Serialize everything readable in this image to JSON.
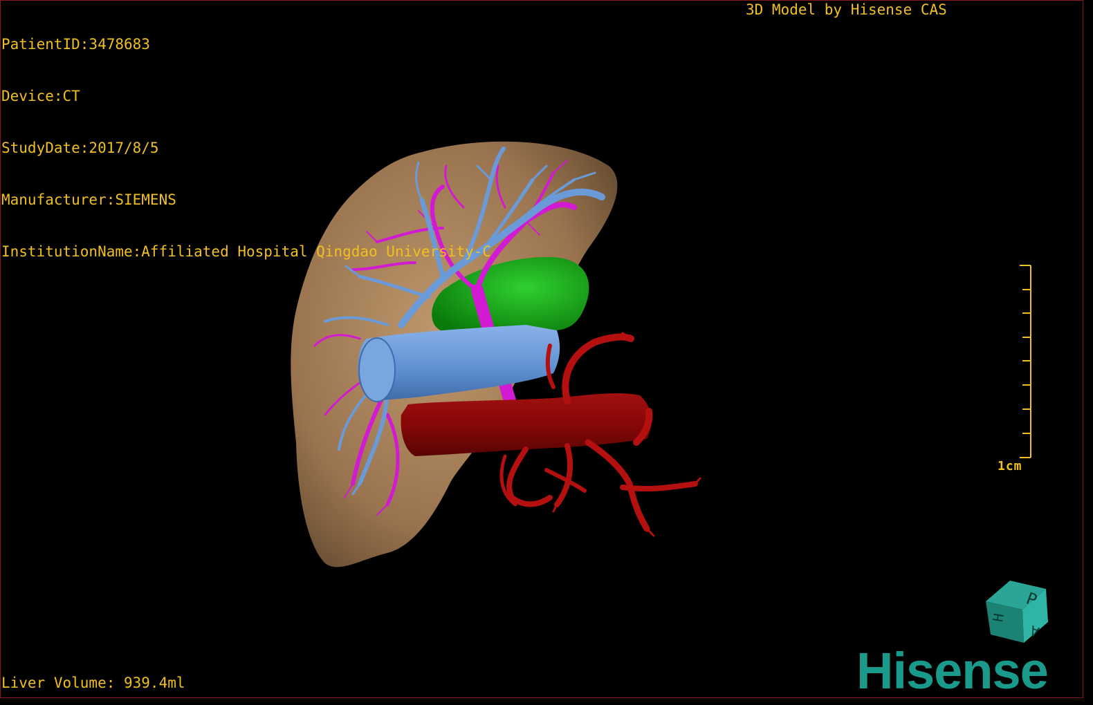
{
  "overlay": {
    "patient_id": "PatientID:3478683",
    "device": "Device:CT",
    "study_date": "StudyDate:2017/8/5",
    "manufacturer": "Manufacturer:SIEMENS",
    "institution": "InstitutionName:Affiliated Hospital Qingdao University-C",
    "model_credit": "3D Model by Hisense CAS",
    "liver_volume": "Liver Volume: 939.4ml"
  },
  "scale_bar": {
    "label": "1cm"
  },
  "orientation_cube": {
    "faces": [
      "P",
      "H",
      "A"
    ],
    "icon": "orientation-cube-icon"
  },
  "brand": {
    "name": "Hisense",
    "color": "#1a9a8a"
  },
  "colors": {
    "text": "#f0c020",
    "liver": "#b48c64",
    "portal_vein": "#6a9ad8",
    "hepatic_vein": "#d21ad2",
    "gallbladder": "#10b010",
    "artery": "#b41010",
    "background": "#000000"
  }
}
